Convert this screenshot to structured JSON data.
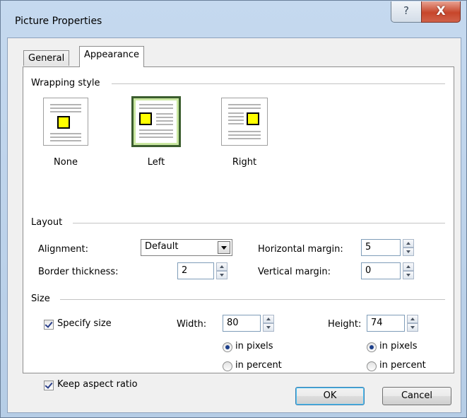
{
  "window": {
    "title": "Picture Properties",
    "help_glyph": "?",
    "close_glyph": "X"
  },
  "tabs": [
    {
      "label": "General"
    },
    {
      "label": "Appearance"
    }
  ],
  "wrapping": {
    "group_label": "Wrapping style",
    "options": [
      {
        "label": "None",
        "selected": false
      },
      {
        "label": "Left",
        "selected": true
      },
      {
        "label": "Right",
        "selected": false
      }
    ]
  },
  "layout": {
    "group_label": "Layout",
    "alignment_label": "Alignment:",
    "alignment_value": "Default",
    "border_label": "Border thickness:",
    "border_value": "2",
    "hmargin_label": "Horizontal margin:",
    "hmargin_value": "5",
    "vmargin_label": "Vertical margin:",
    "vmargin_value": "0"
  },
  "size": {
    "group_label": "Size",
    "specify_label": "Specify size",
    "specify_checked": true,
    "width_label": "Width:",
    "width_value": "80",
    "height_label": "Height:",
    "height_value": "74",
    "in_pixels": "in pixels",
    "in_percent": "in percent",
    "width_unit": "pixels",
    "height_unit": "pixels",
    "keep_aspect_label": "Keep aspect ratio",
    "keep_aspect_checked": true
  },
  "buttons": {
    "ok": "OK",
    "cancel": "Cancel"
  },
  "colors": {
    "picture_fill": "#ffff00",
    "selected_frame": "#c9e7a0",
    "close_button": "#c7462b"
  }
}
